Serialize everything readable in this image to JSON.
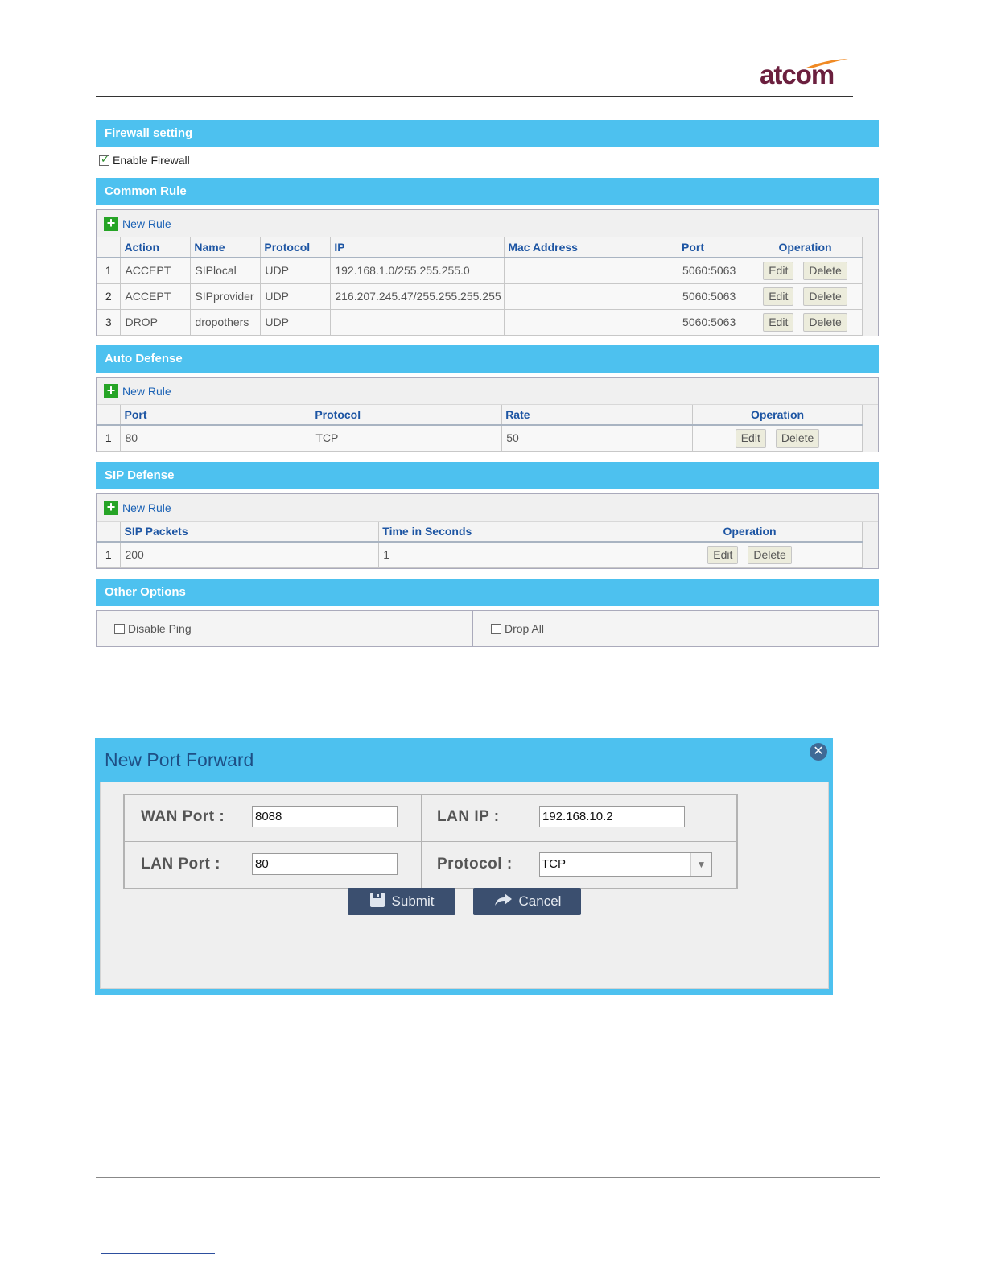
{
  "logo": {
    "text": "atcom"
  },
  "firewall": {
    "title": "Firewall setting",
    "enable_label": "Enable Firewall",
    "enabled": true
  },
  "common_rule": {
    "title": "Common Rule",
    "new_rule": "New Rule",
    "headers": [
      "",
      "Action",
      "Name",
      "Protocol",
      "IP",
      "Mac Address",
      "Port",
      "Operation"
    ],
    "rows": [
      {
        "idx": "1",
        "action": "ACCEPT",
        "name": "SIPlocal",
        "protocol": "UDP",
        "ip": "192.168.1.0/255.255.255.0",
        "mac": "",
        "port": "5060:5063"
      },
      {
        "idx": "2",
        "action": "ACCEPT",
        "name": "SIPprovider",
        "protocol": "UDP",
        "ip": "216.207.245.47/255.255.255.255",
        "mac": "",
        "port": "5060:5063"
      },
      {
        "idx": "3",
        "action": "DROP",
        "name": "dropothers",
        "protocol": "UDP",
        "ip": "",
        "mac": "",
        "port": "5060:5063"
      }
    ]
  },
  "auto_defense": {
    "title": "Auto Defense",
    "new_rule": "New Rule",
    "headers": [
      "",
      "Port",
      "Protocol",
      "Rate",
      "Operation"
    ],
    "rows": [
      {
        "idx": "1",
        "port": "80",
        "protocol": "TCP",
        "rate": "50"
      }
    ]
  },
  "sip_defense": {
    "title": "SIP Defense",
    "new_rule": "New Rule",
    "headers": [
      "",
      "SIP Packets",
      "Time in Seconds",
      "Operation"
    ],
    "rows": [
      {
        "idx": "1",
        "packets": "200",
        "seconds": "1"
      }
    ]
  },
  "other_options": {
    "title": "Other Options",
    "disable_ping": "Disable Ping",
    "drop_all": "Drop All"
  },
  "buttons": {
    "edit": "Edit",
    "delete": "Delete"
  },
  "dialog": {
    "title": "New Port Forward",
    "wan_port_label": "WAN Port :",
    "wan_port_value": "8088",
    "lan_ip_label": "LAN IP :",
    "lan_ip_value": "192.168.10.2",
    "lan_port_label": "LAN Port :",
    "lan_port_value": "80",
    "protocol_label": "Protocol :",
    "protocol_value": "TCP",
    "submit_label": "Submit",
    "cancel_label": "Cancel"
  },
  "colors": {
    "section_bar": "#4dc1ef",
    "header_text": "#1d55a3",
    "button_dark": "#3b4f6f",
    "logo": "#6b1f3e",
    "logo_swoosh": "#f08a24"
  },
  "icons": [
    "plus-icon",
    "checkbox-icon",
    "close-icon",
    "save-icon",
    "cancel-arrow-icon",
    "chevron-down-icon"
  ]
}
